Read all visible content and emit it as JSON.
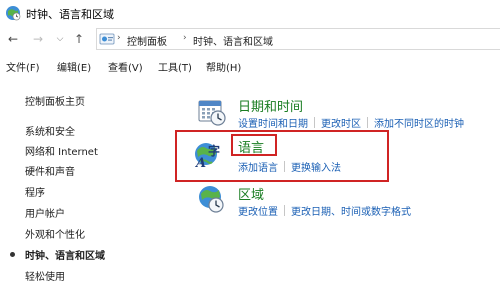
{
  "window": {
    "title": "时钟、语言和区域"
  },
  "address": {
    "crumbs": [
      "控制面板",
      "时钟、语言和区域"
    ]
  },
  "menu": [
    "文件(F)",
    "编辑(E)",
    "查看(V)",
    "工具(T)",
    "帮助(H)"
  ],
  "sidebar": {
    "home": "控制面板主页",
    "items": [
      "系统和安全",
      "网络和 Internet",
      "硬件和声音",
      "程序",
      "用户帐户",
      "外观和个性化",
      "时钟、语言和区域",
      "轻松使用"
    ],
    "current_index": 6
  },
  "categories": [
    {
      "title": "日期和时间",
      "links": [
        "设置时间和日期",
        "更改时区",
        "添加不同时区的时钟"
      ]
    },
    {
      "title": "语言",
      "links": [
        "添加语言",
        "更换输入法"
      ]
    },
    {
      "title": "区域",
      "links": [
        "更改位置",
        "更改日期、时间或数字格式"
      ]
    }
  ],
  "colors": {
    "category_title": "#1a7d22",
    "link": "#1a5fb4",
    "highlight": "#d02424"
  },
  "icons": {
    "title": "clock-language-region-icon",
    "date_time": "calendar-clock-icon",
    "language": "globe-language-icon",
    "region": "globe-clock-icon"
  }
}
